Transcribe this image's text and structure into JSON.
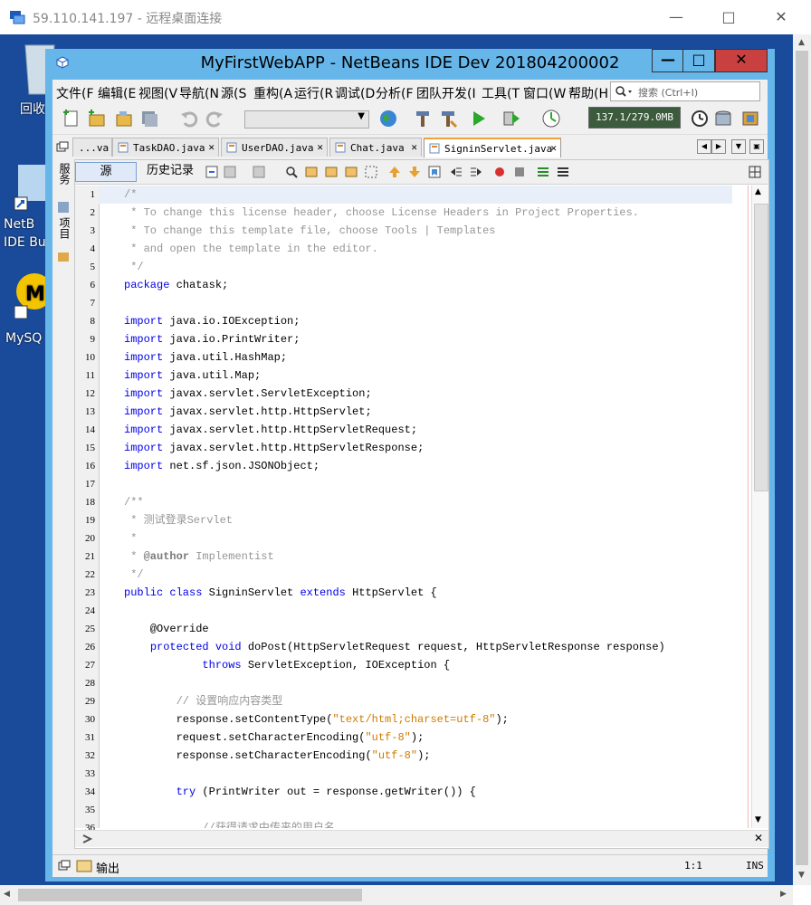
{
  "rdp": {
    "title": "59.110.141.197 - 远程桌面连接",
    "desktop_icons": [
      {
        "label": "回收"
      },
      {
        "label": "NetB\nIDE Bu"
      },
      {
        "label": "MySQ"
      }
    ]
  },
  "netbeans": {
    "title": "MyFirstWebAPP - NetBeans IDE Dev 201804200002",
    "menus": [
      "文件(F",
      "编辑(E",
      "视图(V",
      "导航(N",
      "源(S",
      "重构(A",
      "运行(R",
      "调试(D",
      "分析(F",
      "团队开发(I",
      "工具(T",
      "窗口(W",
      "帮助(H"
    ],
    "search_placeholder": "搜索 (Ctrl+I)",
    "memory": "137.1/279.0MB",
    "tabs": [
      {
        "label": "...va",
        "active": false
      },
      {
        "label": "TaskDAO.java",
        "active": false
      },
      {
        "label": "UserDAO.java",
        "active": false
      },
      {
        "label": "Chat.java",
        "active": false
      },
      {
        "label": "SigninServlet.java",
        "active": true
      }
    ],
    "side_tabs": [
      "服务",
      "项目"
    ],
    "editor_tabs": {
      "source": "源",
      "history": "历史记录"
    },
    "output_label": "输出",
    "caret_position": "1:1",
    "insert_mode": "INS"
  },
  "code": {
    "lines": [
      [
        {
          "t": "/*",
          "c": "cm"
        }
      ],
      [
        {
          "t": " * To change this license header, choose License Headers in Project Properties.",
          "c": "cm"
        }
      ],
      [
        {
          "t": " * To change this template file, choose Tools | Templates",
          "c": "cm"
        }
      ],
      [
        {
          "t": " * and open the template in the editor.",
          "c": "cm"
        }
      ],
      [
        {
          "t": " */",
          "c": "cm"
        }
      ],
      [
        {
          "t": "package",
          "c": "kw"
        },
        {
          "t": " chatask;"
        }
      ],
      [],
      [
        {
          "t": "import",
          "c": "kw"
        },
        {
          "t": " java.io.IOException;"
        }
      ],
      [
        {
          "t": "import",
          "c": "kw"
        },
        {
          "t": " java.io.PrintWriter;"
        }
      ],
      [
        {
          "t": "import",
          "c": "kw"
        },
        {
          "t": " java.util.HashMap;"
        }
      ],
      [
        {
          "t": "import",
          "c": "kw"
        },
        {
          "t": " java.util.Map;"
        }
      ],
      [
        {
          "t": "import",
          "c": "kw"
        },
        {
          "t": " javax.servlet.ServletException;"
        }
      ],
      [
        {
          "t": "import",
          "c": "kw"
        },
        {
          "t": " javax.servlet.http.HttpServlet;"
        }
      ],
      [
        {
          "t": "import",
          "c": "kw"
        },
        {
          "t": " javax.servlet.http.HttpServletRequest;"
        }
      ],
      [
        {
          "t": "import",
          "c": "kw"
        },
        {
          "t": " javax.servlet.http.HttpServletResponse;"
        }
      ],
      [
        {
          "t": "import",
          "c": "kw"
        },
        {
          "t": " net.sf.json.JSONObject;"
        }
      ],
      [],
      [
        {
          "t": "/**",
          "c": "cm"
        }
      ],
      [
        {
          "t": " * 测试登录Servlet",
          "c": "cm"
        }
      ],
      [
        {
          "t": " *",
          "c": "cm"
        }
      ],
      [
        {
          "t": " * ",
          "c": "cm"
        },
        {
          "t": "@author",
          "c": "at"
        },
        {
          "t": " Implementist",
          "c": "cm"
        }
      ],
      [
        {
          "t": " */",
          "c": "cm"
        }
      ],
      [
        {
          "t": "public class",
          "c": "kw"
        },
        {
          "t": " SigninServlet "
        },
        {
          "t": "extends",
          "c": "kw"
        },
        {
          "t": " HttpServlet {"
        }
      ],
      [],
      [
        {
          "t": "    @Override"
        }
      ],
      [
        {
          "t": "    "
        },
        {
          "t": "protected void",
          "c": "kw"
        },
        {
          "t": " doPost(HttpServletRequest request, HttpServletResponse response)"
        }
      ],
      [
        {
          "t": "            "
        },
        {
          "t": "throws",
          "c": "kw"
        },
        {
          "t": " ServletException, IOException {"
        }
      ],
      [],
      [
        {
          "t": "        // 设置响应内容类型",
          "c": "cm"
        }
      ],
      [
        {
          "t": "        response.setContentType("
        },
        {
          "t": "\"text/html;charset=utf-8\"",
          "c": "st"
        },
        {
          "t": ");"
        }
      ],
      [
        {
          "t": "        request.setCharacterEncoding("
        },
        {
          "t": "\"utf-8\"",
          "c": "st"
        },
        {
          "t": ");"
        }
      ],
      [
        {
          "t": "        response.setCharacterEncoding("
        },
        {
          "t": "\"utf-8\"",
          "c": "st"
        },
        {
          "t": ");"
        }
      ],
      [],
      [
        {
          "t": "        "
        },
        {
          "t": "try",
          "c": "kw"
        },
        {
          "t": " (PrintWriter out = response.getWriter()) {"
        }
      ],
      [],
      [
        {
          "t": "            //获得请求中传来的用户名",
          "c": "cm"
        }
      ]
    ]
  }
}
